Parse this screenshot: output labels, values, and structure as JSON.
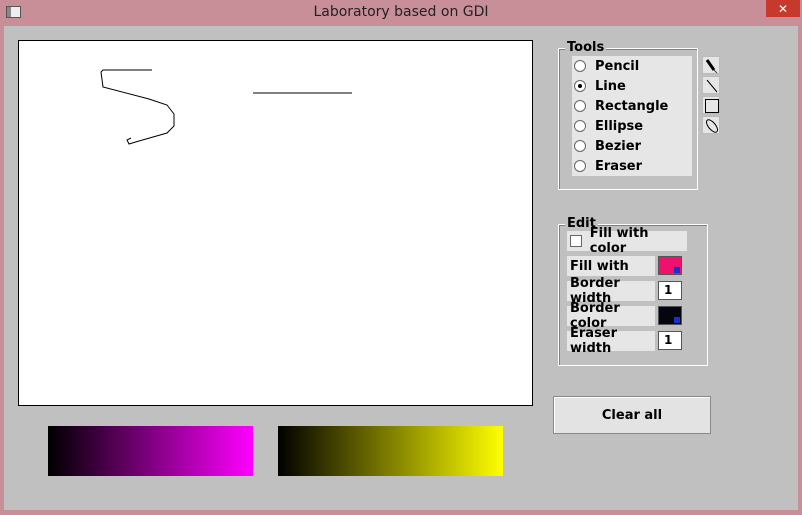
{
  "window": {
    "title": "Laboratory based on GDI",
    "close_glyph": "✕"
  },
  "tools": {
    "group_label": "Tools",
    "options": [
      {
        "label": "Pencil",
        "checked": false
      },
      {
        "label": "Line",
        "checked": true
      },
      {
        "label": "Rectangle",
        "checked": false
      },
      {
        "label": "Ellipse",
        "checked": false
      },
      {
        "label": "Bezier",
        "checked": false
      },
      {
        "label": "Eraser",
        "checked": false
      }
    ],
    "icons": [
      "pencil-icon",
      "line-icon",
      "rectangle-icon",
      "ellipse-icon"
    ]
  },
  "edit": {
    "group_label": "Edit",
    "fill_with_color_label": "Fill with color",
    "fill_with_color_checked": false,
    "fill_with_label": "Fill with",
    "fill_color": "#f0106e",
    "border_width_label": "Border width",
    "border_width_value": "1",
    "border_color_label": "Border color",
    "border_color": "#050510",
    "eraser_width_label": "Eraser width",
    "eraser_width_value": "1"
  },
  "clear_all_label": "Clear all",
  "gradients": {
    "fill_gradient": {
      "from": "#000000",
      "to": "#ff00ff"
    },
    "border_gradient": {
      "from": "#000000",
      "to": "#ffff00"
    }
  }
}
